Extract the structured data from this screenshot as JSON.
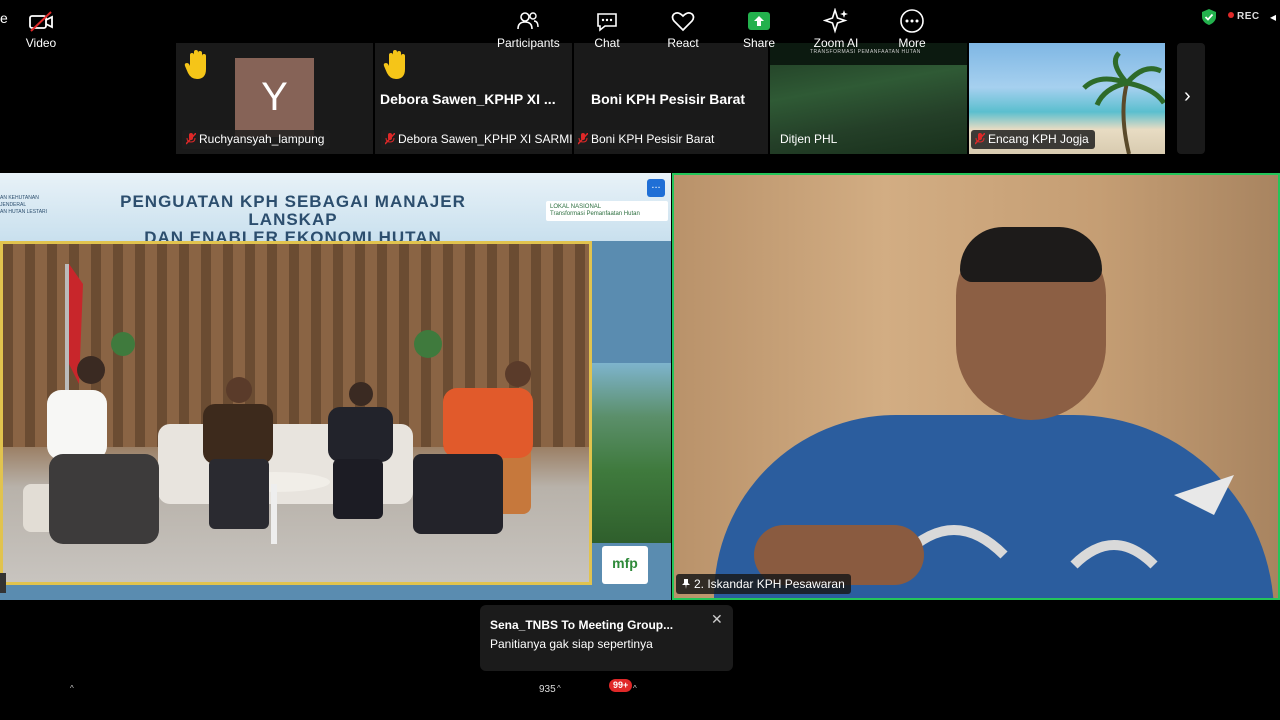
{
  "topbar": {
    "title_fragment": "e",
    "rec_label": "REC"
  },
  "strip": {
    "tiles": [
      {
        "name": "Ruchyansyah_lampung",
        "avatar_letter": "Y",
        "hand_raised": true
      },
      {
        "name": "Debora Sawen_KPHP XI SARMI ...",
        "big_name": "Debora Sawen_KPHP XI ...",
        "hand_raised": true
      },
      {
        "name": "Boni KPH Pesisir Barat",
        "big_name": "Boni KPH Pesisir Barat"
      },
      {
        "name": "Ditjen PHL",
        "banner_text": "TRANSFORMASI PEMANFAATAN HUTAN"
      },
      {
        "name": "Encang KPH Jogja"
      }
    ],
    "next_icon": "chevron-right-icon"
  },
  "share": {
    "title_line1": "PENGUATAN KPH SEBAGAI MANAJER LANSKAP",
    "title_line2": "DAN ENABLER EKONOMI HUTAN",
    "org_line1": "AN KEHUTANAN",
    "org_line2": "JENDERAL",
    "org_line3": "AN HUTAN LESTARI",
    "logo_line1": "LOKAL NASIONAL",
    "logo_line2": "Transformasi Pemanfaatan Hutan",
    "mfp_label": "mfp",
    "more_label": "..."
  },
  "speaker": {
    "name": "2. Iskandar KPH Pesawaran"
  },
  "toast": {
    "from": "Sena_TNBS To Meeting Group...",
    "message": "Panitianya gak siap sepertinya"
  },
  "toolbar": {
    "video_label": "Video",
    "participants_label": "Participants",
    "participants_count": "935",
    "chat_label": "Chat",
    "chat_badge": "99+",
    "react_label": "React",
    "share_label": "Share",
    "zoom_ai_label": "Zoom AI",
    "more_label": "More"
  },
  "colors": {
    "active_speaker_border": "#24c55a",
    "share_green": "#23b14d",
    "rec_red": "#e02828",
    "muted_red": "#e02828",
    "raised_hand": "#f5c518"
  }
}
